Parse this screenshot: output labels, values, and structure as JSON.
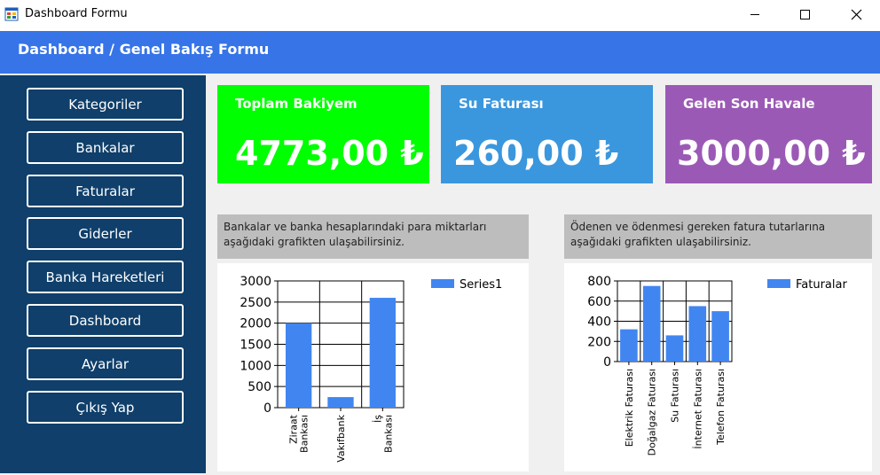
{
  "window": {
    "title": "Dashboard Formu"
  },
  "header": {
    "title": "Dashboard / Genel Bakış Formu"
  },
  "sidebar": {
    "items": [
      {
        "label": "Kategoriler"
      },
      {
        "label": "Bankalar"
      },
      {
        "label": "Faturalar"
      },
      {
        "label": "Giderler"
      },
      {
        "label": "Banka Hareketleri"
      },
      {
        "label": "Dashboard"
      },
      {
        "label": "Ayarlar"
      },
      {
        "label": "Çıkış Yap"
      }
    ]
  },
  "cards": [
    {
      "title": "Toplam Bakiyem",
      "value": "4773,00 ₺",
      "color": "#00ff00"
    },
    {
      "title": "Su Faturası",
      "value": "260,00 ₺",
      "color": "#3a97dd"
    },
    {
      "title": "Gelen Son Havale",
      "value": "3000,00 ₺",
      "color": "#9b59b6"
    }
  ],
  "descriptions": {
    "banks": [
      "Bankalar ve banka hesaplarındaki para miktarları",
      "aşağıdaki grafikten ulaşabilirsiniz."
    ],
    "bills": [
      "Ödenen ve ödenmesi gereken fatura tutarlarına",
      "aşağıdaki grafikten ulaşabilirsiniz."
    ]
  },
  "colors": {
    "bar": "#4186f0",
    "header": "#3674e8",
    "sidebar": "#0f3f6a"
  },
  "chart_data": [
    {
      "type": "bar",
      "categories": [
        "Ziraat Bankası",
        "Vakıfbank",
        "İş Bankası"
      ],
      "category_lines": [
        [
          "Ziraat",
          "Bankası"
        ],
        [
          "Vakıfbank"
        ],
        [
          "İş",
          "Bankası"
        ]
      ],
      "series": [
        {
          "name": "Series1",
          "values": [
            2000,
            250,
            2600
          ]
        }
      ],
      "ylim": [
        0,
        3000
      ],
      "yticks": [
        0,
        500,
        1000,
        1500,
        2000,
        2500,
        3000
      ],
      "legend": "top-right",
      "grid": true
    },
    {
      "type": "bar",
      "categories": [
        "Elektrik Faturası",
        "Doğalgaz Faturası",
        "Su Faturası",
        "İnternet Faturası",
        "Telefon Faturası"
      ],
      "category_lines": [
        [
          "Elektrik Faturası"
        ],
        [
          "Doğalgaz Faturası"
        ],
        [
          "Su Faturası"
        ],
        [
          "İnternet Faturası"
        ],
        [
          "Telefon Faturası"
        ]
      ],
      "series": [
        {
          "name": "Faturalar",
          "values": [
            320,
            750,
            260,
            550,
            500
          ]
        }
      ],
      "ylim": [
        0,
        800
      ],
      "yticks": [
        0,
        200,
        400,
        600,
        800
      ],
      "legend": "top-right",
      "grid": true
    }
  ]
}
